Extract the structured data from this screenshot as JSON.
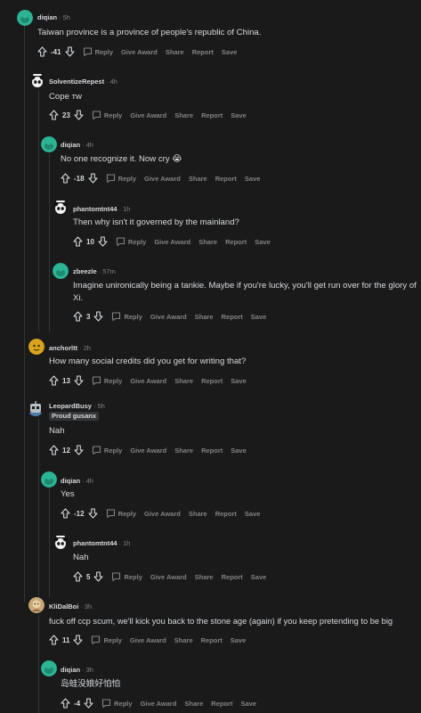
{
  "comments": [
    {
      "author": "diqian",
      "time": "5h",
      "body": "Taiwan province is a province of people's republic of China.",
      "score": "-41",
      "avatar": "green"
    },
    {
      "author": "SolventizeRepest",
      "time": "4h",
      "body": "Cope ᴛᴡ",
      "score": "23",
      "avatar": "panda"
    },
    {
      "author": "diqian",
      "time": "4h",
      "body": "No one recognize it. Now cry 😭",
      "score": "-18",
      "avatar": "green"
    },
    {
      "author": "phantomtnt44",
      "time": "1h",
      "body": "Then why isn't it governed by the mainland?",
      "score": "10",
      "avatar": "panda"
    },
    {
      "author": "zbeezle",
      "time": "57m",
      "body": "Imagine unironically being a tankie. Maybe if you're lucky, you'll get run over for the glory of Xi.",
      "score": "3",
      "avatar": "green"
    },
    {
      "author": "anchorltt",
      "time": "2h",
      "body": "How many social credits did you get for writing that?",
      "score": "13",
      "avatar": "yellow"
    },
    {
      "author": "LeopardBusy",
      "time": "5h",
      "flair": "Proud gusanx",
      "body": "Nah",
      "score": "12",
      "avatar": "robot"
    },
    {
      "author": "diqian",
      "time": "4h",
      "body": "Yes",
      "score": "-12",
      "avatar": "green"
    },
    {
      "author": "phantomtnt44",
      "time": "1h",
      "body": "Nah",
      "score": "5",
      "avatar": "panda"
    },
    {
      "author": "KliDalBoi",
      "time": "3h",
      "body": "fuck off ccp scum, we'll kick you back to the stone age (again) if you keep pretending to be big",
      "score": "11",
      "avatar": "tan"
    },
    {
      "author": "diqian",
      "time": "3h",
      "body": "岛蛙没娘好怕怕",
      "score": "-4",
      "avatar": "green"
    }
  ],
  "actions": {
    "reply": "Reply",
    "award": "Give Award",
    "share": "Share",
    "report": "Report",
    "save": "Save"
  },
  "colors": {
    "background": "#1a1a1b",
    "text": "#d7dadc",
    "muted": "#818384",
    "thread_line": "#343536",
    "avatar_green": "#2bb595",
    "avatar_yellow": "#d9a41b",
    "avatar_tan": "#c9a878"
  }
}
